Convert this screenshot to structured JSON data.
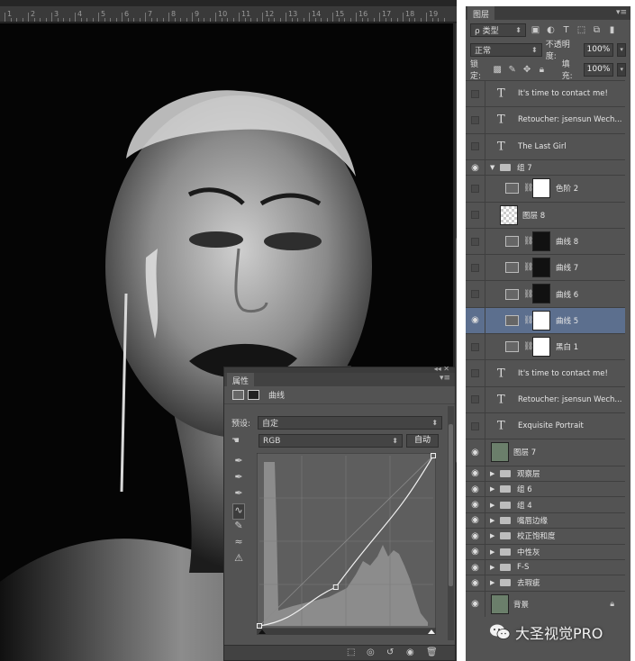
{
  "ruler": {
    "ticks": [
      "1",
      "2",
      "3",
      "4",
      "5",
      "6",
      "7",
      "8",
      "9",
      "10",
      "11",
      "12",
      "13",
      "14",
      "15",
      "16",
      "17",
      "18",
      "19"
    ]
  },
  "layers_panel": {
    "tab_label": "图层",
    "menu_icon": "panel-menu-icon",
    "filter_label": "ρ 类型",
    "blend_mode": "正常",
    "opacity_label": "不透明度:",
    "opacity_value": "100%",
    "lock_label": "锁定:",
    "fill_label": "填充:",
    "fill_value": "100%",
    "layers": [
      {
        "name": "It's time to contact me!",
        "kind": "text",
        "visible": false
      },
      {
        "name": "Retoucher: jsensun Wech...",
        "kind": "text",
        "visible": false
      },
      {
        "name": "The Last Girl",
        "kind": "text",
        "visible": false
      },
      {
        "name": "组 7",
        "kind": "group-open",
        "visible": true
      },
      {
        "name": "色阶 2",
        "kind": "adjustment-levels",
        "visible": false
      },
      {
        "name": "图层 8",
        "kind": "pixel-transparent",
        "visible": false
      },
      {
        "name": "曲线 8",
        "kind": "adjustment-curves",
        "visible": false
      },
      {
        "name": "曲线 7",
        "kind": "adjustment-curves",
        "visible": false
      },
      {
        "name": "曲线 6",
        "kind": "adjustment-curves",
        "visible": false
      },
      {
        "name": "曲线 5",
        "kind": "adjustment-curves",
        "visible": true,
        "selected": true
      },
      {
        "name": "黑白 1",
        "kind": "adjustment-bw",
        "visible": false
      },
      {
        "name": "It's time to contact me!",
        "kind": "text",
        "visible": false
      },
      {
        "name": "Retoucher: jsensun Wech...",
        "kind": "text",
        "visible": false
      },
      {
        "name": "Exquisite Portrait",
        "kind": "text",
        "visible": false
      },
      {
        "name": "图层 7",
        "kind": "pixel-photo",
        "visible": true
      },
      {
        "name": "观察层",
        "kind": "group",
        "visible": true
      },
      {
        "name": "组 6",
        "kind": "group",
        "visible": true
      },
      {
        "name": "组 4",
        "kind": "group",
        "visible": true
      },
      {
        "name": "嘴唇边缘",
        "kind": "group",
        "visible": true
      },
      {
        "name": "校正饱和度",
        "kind": "group",
        "visible": true
      },
      {
        "name": "中性灰",
        "kind": "group",
        "visible": true
      },
      {
        "name": "F-S",
        "kind": "group",
        "visible": true
      },
      {
        "name": "去瑕疵",
        "kind": "group",
        "visible": true
      },
      {
        "name": "背景",
        "kind": "background",
        "visible": true
      }
    ]
  },
  "properties_panel": {
    "tab_label": "属性",
    "adjustment_name": "曲线",
    "preset_label": "预设:",
    "preset_value": "自定",
    "channel_value": "RGB",
    "auto_button": "自动",
    "curve_points": [
      [
        0,
        0
      ],
      [
        112,
        58
      ],
      [
        255,
        255
      ]
    ]
  },
  "watermark": {
    "text": "大圣视觉PRO"
  },
  "colors": {
    "panel_bg": "#535353",
    "selected_layer": "#5c6f8e",
    "canvas_bg": "#262626"
  }
}
